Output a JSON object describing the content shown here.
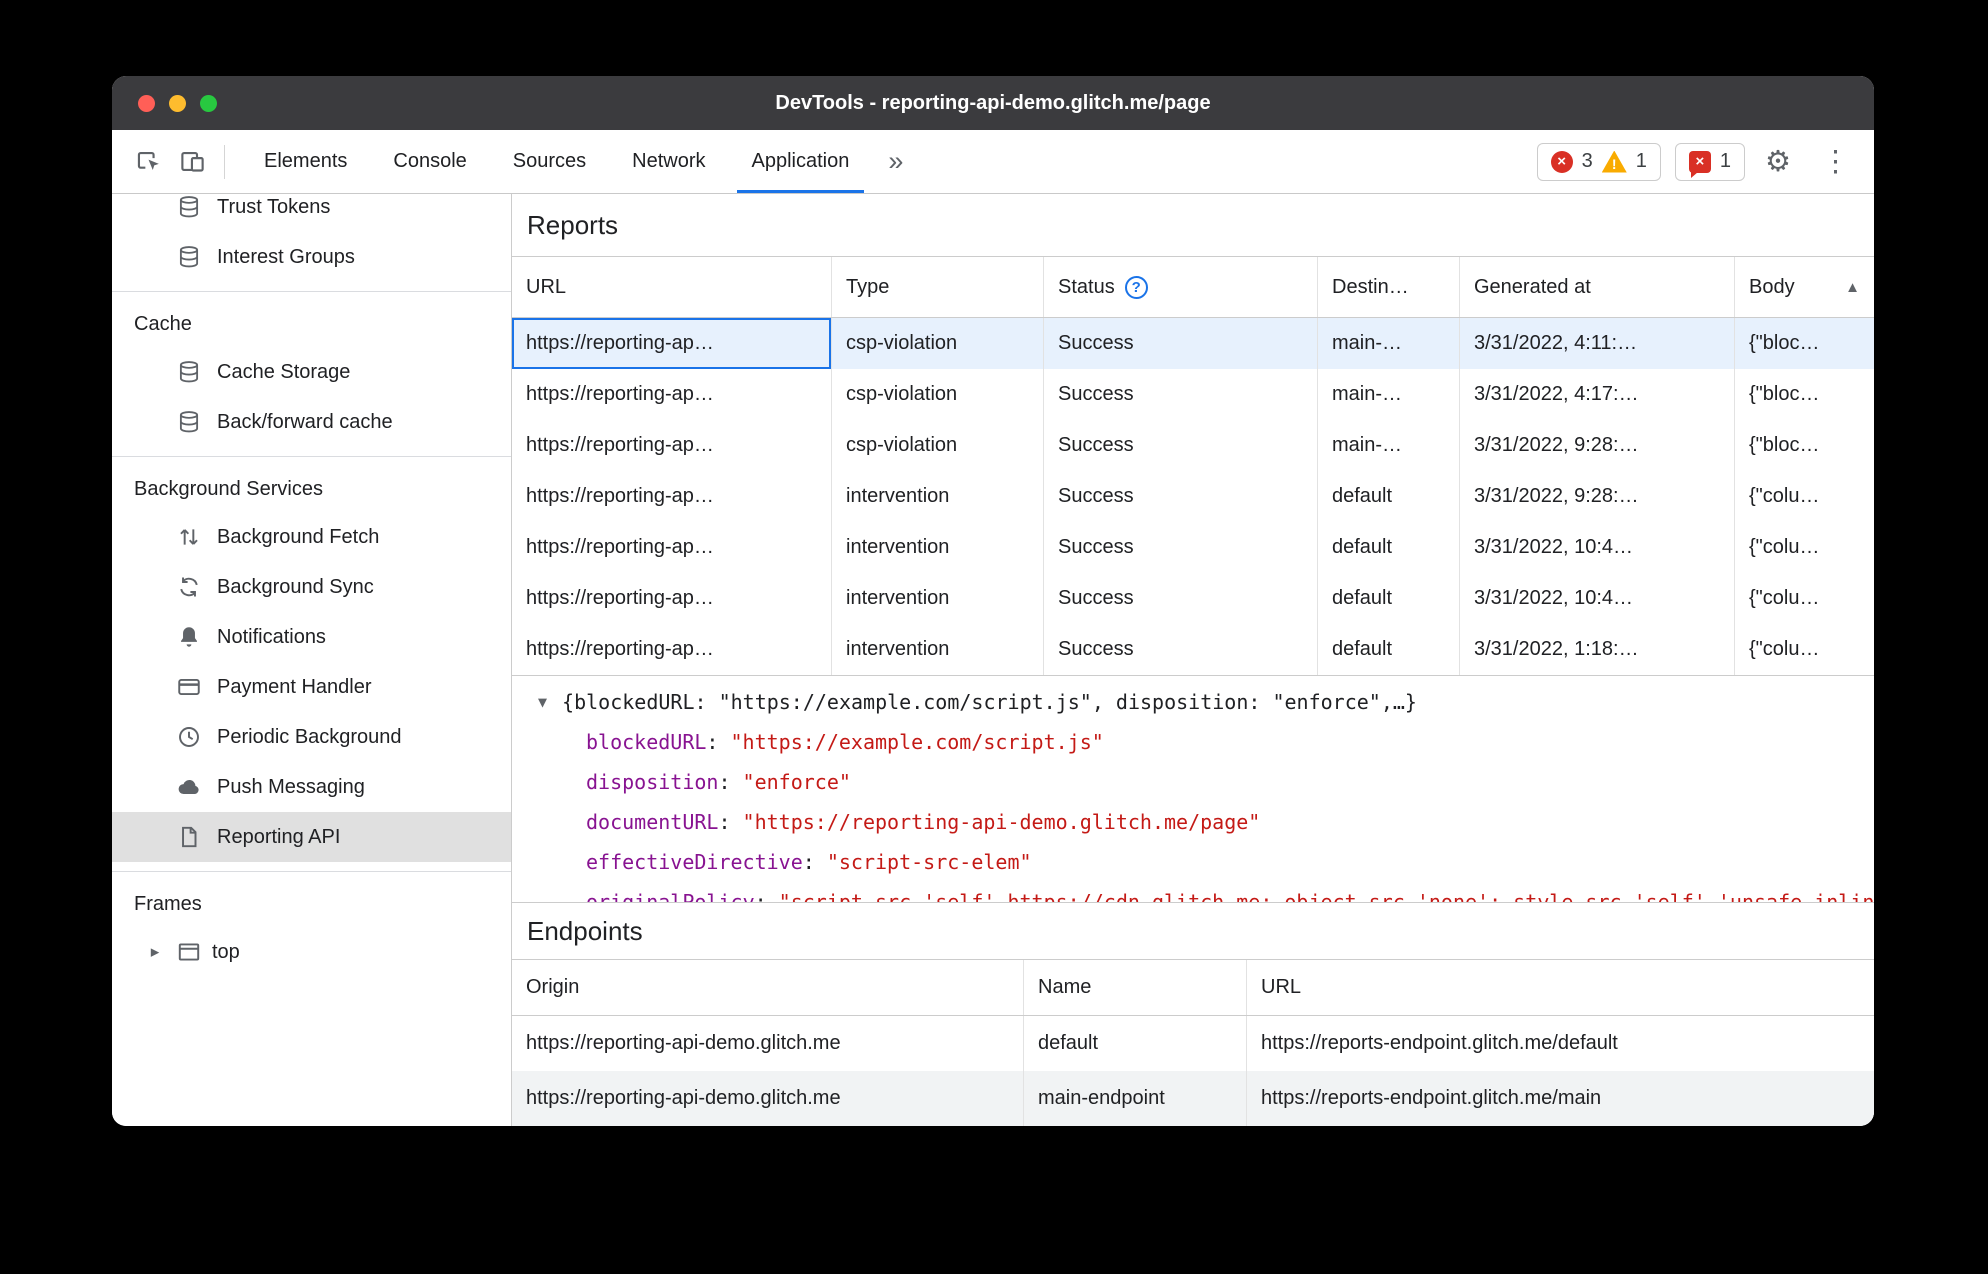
{
  "colors": {
    "accent_blue": "#1a73e8",
    "error_red": "#d93025",
    "warning_yellow": "#f9ab00",
    "property_key_purple": "#881391",
    "string_value_red": "#c41a16",
    "selected_row_blue": "#e7f1fd"
  },
  "window": {
    "title": "DevTools - reporting-api-demo.glitch.me/page"
  },
  "toolbar": {
    "left_icons": [
      "inspect-element-icon",
      "device-toolbar-icon"
    ],
    "tabs": [
      "Elements",
      "Console",
      "Sources",
      "Network",
      "Application"
    ],
    "selected_tab": "Application",
    "more_tabs_glyph": "»",
    "badges": {
      "errors": "3",
      "warnings": "1",
      "issues": "1"
    },
    "right_icons": [
      "settings-gear-icon",
      "kebab-menu-icon"
    ]
  },
  "sidebar": {
    "sections": [
      {
        "header": null,
        "items": [
          {
            "label": "Trust Tokens",
            "icon": "database-icon"
          },
          {
            "label": "Interest Groups",
            "icon": "database-icon"
          }
        ]
      },
      {
        "header": "Cache",
        "items": [
          {
            "label": "Cache Storage",
            "icon": "database-icon"
          },
          {
            "label": "Back/forward cache",
            "icon": "database-icon"
          }
        ]
      },
      {
        "header": "Background Services",
        "items": [
          {
            "label": "Background Fetch",
            "icon": "background-fetch-icon"
          },
          {
            "label": "Background Sync",
            "icon": "background-sync-icon"
          },
          {
            "label": "Notifications",
            "icon": "bell-icon"
          },
          {
            "label": "Payment Handler",
            "icon": "payment-card-icon"
          },
          {
            "label": "Periodic Background",
            "icon": "clock-icon"
          },
          {
            "label": "Push Messaging",
            "icon": "cloud-icon"
          },
          {
            "label": "Reporting API",
            "icon": "file-icon",
            "selected": true
          }
        ]
      },
      {
        "header": "Frames",
        "items": [
          {
            "label": "top",
            "icon": "frame-icon",
            "expander": true
          }
        ]
      }
    ]
  },
  "reports": {
    "title": "Reports",
    "columns": [
      "URL",
      "Type",
      "Status",
      "Destin…",
      "Generated at",
      "Body"
    ],
    "status_help_icon": "help-icon",
    "body_sort_icon": "sort-ascending-icon",
    "rows": [
      {
        "url": "https://reporting-ap…",
        "type": "csp-violation",
        "status": "Success",
        "destination": "main-…",
        "generated_at": "3/31/2022, 4:11:…",
        "body": "{\"bloc…",
        "selected": true
      },
      {
        "url": "https://reporting-ap…",
        "type": "csp-violation",
        "status": "Success",
        "destination": "main-…",
        "generated_at": "3/31/2022, 4:17:…",
        "body": "{\"bloc…"
      },
      {
        "url": "https://reporting-ap…",
        "type": "csp-violation",
        "status": "Success",
        "destination": "main-…",
        "generated_at": "3/31/2022, 9:28:…",
        "body": "{\"bloc…"
      },
      {
        "url": "https://reporting-ap…",
        "type": "intervention",
        "status": "Success",
        "destination": "default",
        "generated_at": "3/31/2022, 9:28:…",
        "body": "{\"colu…"
      },
      {
        "url": "https://reporting-ap…",
        "type": "intervention",
        "status": "Success",
        "destination": "default",
        "generated_at": "3/31/2022, 10:4…",
        "body": "{\"colu…"
      },
      {
        "url": "https://reporting-ap…",
        "type": "intervention",
        "status": "Success",
        "destination": "default",
        "generated_at": "3/31/2022, 10:4…",
        "body": "{\"colu…"
      },
      {
        "url": "https://reporting-ap…",
        "type": "intervention",
        "status": "Success",
        "destination": "default",
        "generated_at": "3/31/2022, 1:18:…",
        "body": "{\"colu…"
      }
    ]
  },
  "preview": {
    "summary": "{blockedURL: \"https://example.com/script.js\", disposition: \"enforce\",…}",
    "properties": [
      {
        "key": "blockedURL",
        "value": "\"https://example.com/script.js\""
      },
      {
        "key": "disposition",
        "value": "\"enforce\""
      },
      {
        "key": "documentURL",
        "value": "\"https://reporting-api-demo.glitch.me/page\""
      },
      {
        "key": "effectiveDirective",
        "value": "\"script-src-elem\""
      }
    ],
    "clipped": {
      "key": "originalPolicy",
      "value": "\"script-src 'self' https://cdn.glitch.me; object-src 'none'; style-src 'self' 'unsafe-inline'; report-to main-endpoint\""
    }
  },
  "endpoints": {
    "title": "Endpoints",
    "columns": [
      "Origin",
      "Name",
      "URL"
    ],
    "rows": [
      {
        "origin": "https://reporting-api-demo.glitch.me",
        "name": "default",
        "url": "https://reports-endpoint.glitch.me/default"
      },
      {
        "origin": "https://reporting-api-demo.glitch.me",
        "name": "main-endpoint",
        "url": "https://reports-endpoint.glitch.me/main"
      }
    ]
  }
}
